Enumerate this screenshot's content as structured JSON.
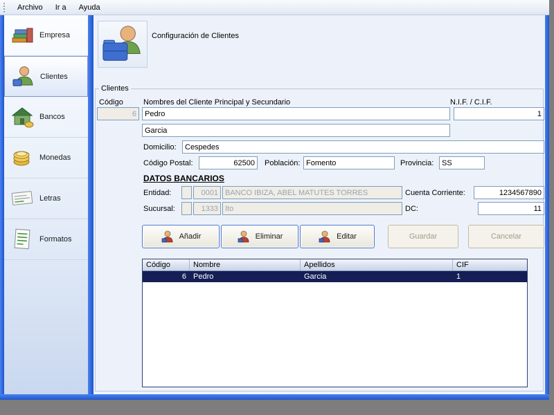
{
  "menu": {
    "items": [
      "Archivo",
      "Ir a",
      "Ayuda"
    ]
  },
  "sidebar": {
    "items": [
      {
        "label": "Empresa"
      },
      {
        "label": "Clientes"
      },
      {
        "label": "Bancos"
      },
      {
        "label": "Monedas"
      },
      {
        "label": "Letras"
      },
      {
        "label": "Formatos"
      }
    ]
  },
  "header": {
    "title": "Configuración de Clientes"
  },
  "clientes": {
    "legend": "Clientes",
    "codigo_label": "Código",
    "codigo_value": "6",
    "nombres_label": "Nombres del Cliente Principal y Secundario",
    "nif_label": "N.I.F. / C.I.F.",
    "nombre_value": "Pedro",
    "nif_value": "1",
    "apellidos_value": "Garcia",
    "domicilio_label": "Domicilio:",
    "domicilio_value": "Cespedes",
    "codigo_postal_label": "Código Postal:",
    "codigo_postal_value": "62500",
    "poblacion_label": "Población:",
    "poblacion_value": "Fomento",
    "provincia_label": "Provincia:",
    "provincia_value": "SS"
  },
  "bancarios": {
    "title": "DATOS BANCARIOS",
    "entidad_label": "Entidad:",
    "entidad_codigo": "0001",
    "entidad_nombre": "BANCO IBIZA, ABEL MATUTES TORRES",
    "cuenta_corriente_label": "Cuenta Corriente:",
    "cuenta_corriente_value": "1234567890",
    "sucursal_label": "Sucursal:",
    "sucursal_codigo": "1333",
    "sucursal_nombre": "Ito",
    "dc_label": "DC:",
    "dc_value": "11"
  },
  "actions": {
    "anadir": "Añadir",
    "eliminar": "Eliminar",
    "editar": "Editar",
    "guardar": "Guardar",
    "cancelar": "Cancelar"
  },
  "grid": {
    "headers": [
      "Código",
      "Nombre",
      "Apellidos",
      "CIF"
    ],
    "rows": [
      {
        "codigo": "6",
        "nombre": "Pedro",
        "apellidos": "Garcia",
        "cif": "1"
      }
    ]
  }
}
